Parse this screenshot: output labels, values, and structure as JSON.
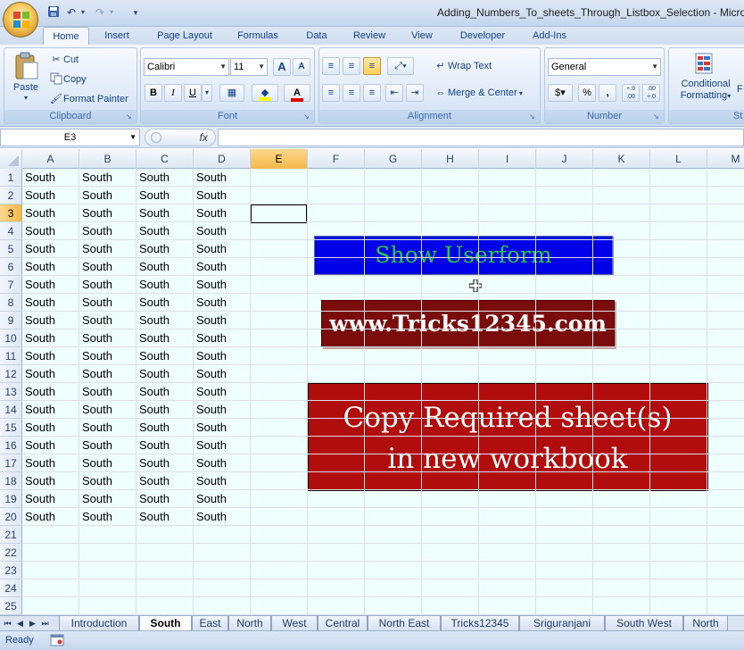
{
  "window": {
    "title": "Adding_Numbers_To_sheets_Through_Listbox_Selection - Micros"
  },
  "ribbon_tabs": [
    "Home",
    "Insert",
    "Page Layout",
    "Formulas",
    "Data",
    "Review",
    "View",
    "Developer",
    "Add-Ins"
  ],
  "clipboard": {
    "paste": "Paste",
    "cut": "Cut",
    "copy": "Copy",
    "format_painter": "Format Painter",
    "label": "Clipboard"
  },
  "font": {
    "name": "Calibri",
    "size": "11",
    "grow": "A",
    "shrink": "A",
    "bold": "B",
    "italic": "I",
    "underline": "U",
    "label": "Font"
  },
  "alignment": {
    "wrap_text": "Wrap Text",
    "merge_center": "Merge & Center",
    "label": "Alignment"
  },
  "number": {
    "format": "General",
    "currency": "$",
    "percent": "%",
    "comma": ",",
    "inc_decimal": "+.0 .00",
    "dec_decimal": ".00 +.0",
    "label": "Number"
  },
  "styles": {
    "conditional_formatting_line1": "Conditional",
    "conditional_formatting_line2": "Formatting",
    "format_as_fragment": "F as",
    "label_fragment": "St"
  },
  "formula_bar": {
    "name_box": "E3",
    "fx": "fx",
    "formula": ""
  },
  "columns": [
    "A",
    "B",
    "C",
    "D",
    "E",
    "F",
    "G",
    "H",
    "I",
    "J",
    "K",
    "L",
    "M"
  ],
  "rows": [
    "1",
    "2",
    "3",
    "4",
    "5",
    "6",
    "7",
    "8",
    "9",
    "10",
    "11",
    "12",
    "13",
    "14",
    "15",
    "16",
    "17",
    "18",
    "19",
    "20",
    "21",
    "22",
    "23",
    "24",
    "25"
  ],
  "selected_cell": "E3",
  "cell_value": "South",
  "shapes": {
    "show_userform": "Show Userform",
    "tricks_link": "www.Tricks12345.com",
    "copy_line1": "Copy Required sheet(s)",
    "copy_line2": "in new workbook"
  },
  "sheet_tabs": [
    "Introduction",
    "South",
    "East",
    "North",
    "West",
    "Central",
    "North East",
    "Tricks12345",
    "Sriguranjani",
    "South West",
    "North"
  ],
  "active_sheet": "South",
  "status": {
    "text": "Ready"
  },
  "colors": {
    "show_userform_bg": "#0000e8",
    "show_userform_text": "#22cc44",
    "tricks_bg": "#7a0c0c",
    "copy_bg": "#b20d0d",
    "grid_bg": "#effffe"
  }
}
